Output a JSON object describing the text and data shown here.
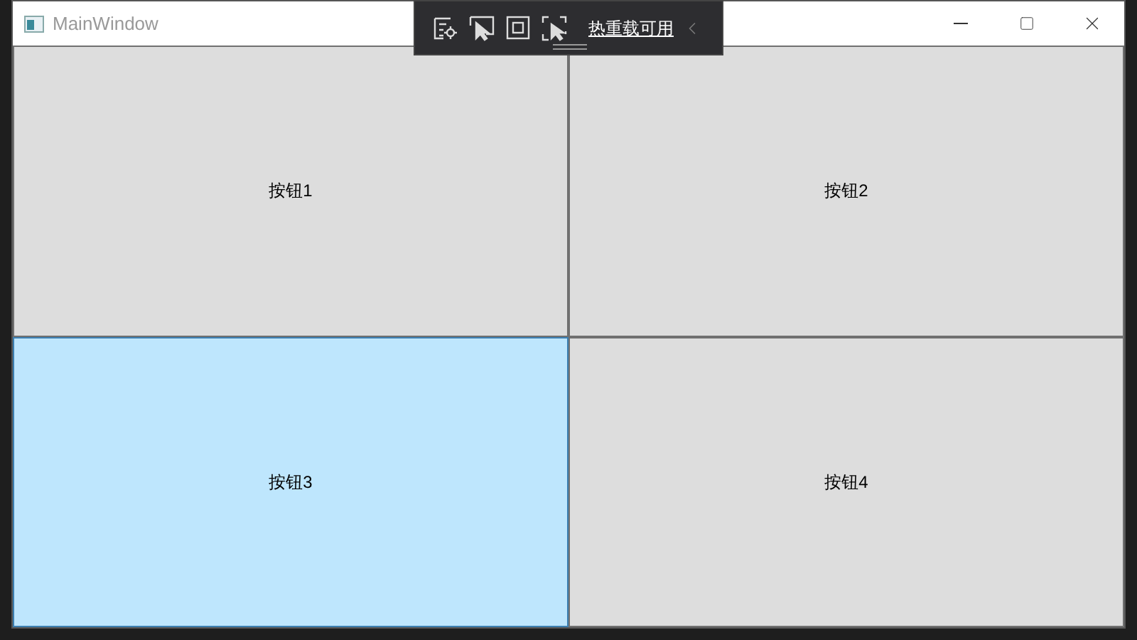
{
  "window": {
    "title": "MainWindow"
  },
  "hot_reload_toolbar": {
    "status": "热重载可用"
  },
  "buttons": [
    {
      "label": "按钮1",
      "hovered": false
    },
    {
      "label": "按钮2",
      "hovered": false
    },
    {
      "label": "按钮3",
      "hovered": true
    },
    {
      "label": "按钮4",
      "hovered": false
    }
  ]
}
